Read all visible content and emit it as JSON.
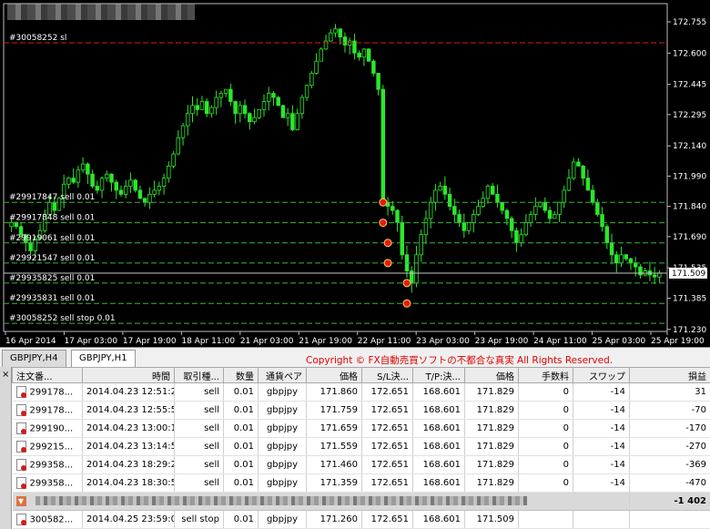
{
  "chart_data": {
    "type": "candlestick",
    "symbol": "GBPJPY,H1",
    "price_axis": [
      "172.755",
      "172.600",
      "172.445",
      "172.295",
      "172.140",
      "171.990",
      "171.840",
      "171.690",
      "171.535",
      "171.385",
      "171.230"
    ],
    "ylim": [
      171.23,
      172.78
    ],
    "current_price": "171.509",
    "time_axis": [
      "16 Apr 2014",
      "17 Apr 03:00",
      "17 Apr 19:00",
      "18 Apr 11:00",
      "21 Apr 03:00",
      "21 Apr 19:00",
      "22 Apr 11:00",
      "23 Apr 03:00",
      "23 Apr 19:00",
      "24 Apr 11:00",
      "25 Apr 03:00",
      "25 Apr 19:00"
    ],
    "order_lines": [
      {
        "label": "#30058252 sl",
        "price": 172.651,
        "color": "#d42020",
        "style": "dash"
      },
      {
        "label": "#29917847 sell 0.01",
        "price": 171.86,
        "color": "#39b539",
        "style": "dash"
      },
      {
        "label": "#29917848 sell 0.01",
        "price": 171.759,
        "color": "#39b539",
        "style": "dash"
      },
      {
        "label": "#29919061 sell 0.01",
        "price": 171.659,
        "color": "#39b539",
        "style": "dash"
      },
      {
        "label": "#29921547 sell 0.01",
        "price": 171.559,
        "color": "#39b539",
        "style": "dash"
      },
      {
        "label": "#29935825 sell 0.01",
        "price": 171.46,
        "color": "#39b539",
        "style": "dash"
      },
      {
        "label": "#29935831 sell 0.01",
        "price": 171.359,
        "color": "#39b539",
        "style": "dash"
      },
      {
        "label": "#30058252 sell stop 0.01",
        "price": 171.26,
        "color": "#39b539",
        "style": "dash"
      }
    ],
    "bid_line": 171.509,
    "grid": false,
    "close_series": [
      171.76,
      171.74,
      171.7,
      171.66,
      171.62,
      171.68,
      171.72,
      171.8,
      171.86,
      171.82,
      171.88,
      171.95,
      171.98,
      171.96,
      172.02,
      172.05,
      172.0,
      171.94,
      171.92,
      171.98,
      172.0,
      171.96,
      171.92,
      171.9,
      171.94,
      171.97,
      171.92,
      171.88,
      171.86,
      171.9,
      171.92,
      171.94,
      171.98,
      172.04,
      172.1,
      172.18,
      172.24,
      172.3,
      172.34,
      172.32,
      172.36,
      172.3,
      172.33,
      172.38,
      172.4,
      172.42,
      172.36,
      172.3,
      172.34,
      172.3,
      172.26,
      172.28,
      172.32,
      172.36,
      172.4,
      172.38,
      172.34,
      172.28,
      172.3,
      172.22,
      172.3,
      172.38,
      172.44,
      172.5,
      172.56,
      172.62,
      172.66,
      172.7,
      172.72,
      172.68,
      172.64,
      172.66,
      172.6,
      172.58,
      172.62,
      172.56,
      172.5,
      172.42,
      171.86,
      171.84,
      171.82,
      171.76,
      171.6,
      171.52,
      171.46,
      171.6,
      171.7,
      171.78,
      171.86,
      171.92,
      171.94,
      171.9,
      171.84,
      171.8,
      171.76,
      171.72,
      171.76,
      171.8,
      171.84,
      171.88,
      171.94,
      171.9,
      171.86,
      171.82,
      171.78,
      171.72,
      171.66,
      171.7,
      171.76,
      171.8,
      171.84,
      171.86,
      171.82,
      171.78,
      171.8,
      171.86,
      171.92,
      171.98,
      172.06,
      172.04,
      171.98,
      171.92,
      171.86,
      171.8,
      171.74,
      171.66,
      171.6,
      171.56,
      171.6,
      171.58,
      171.56,
      171.54,
      171.5,
      171.52,
      171.5,
      171.49,
      171.51
    ],
    "markers": [
      {
        "price": 171.86,
        "index": 78
      },
      {
        "price": 171.759,
        "index": 78
      },
      {
        "price": 171.659,
        "index": 79
      },
      {
        "price": 171.559,
        "index": 79
      },
      {
        "price": 171.46,
        "index": 83
      },
      {
        "price": 171.359,
        "index": 83
      }
    ]
  },
  "tabs": [
    "GBPJPY,H4",
    "GBPJPY,H1"
  ],
  "copyright": "Copyright © FX自動売買ソフトの不都合な真実 All Rights Reserved.",
  "terminal": {
    "close_label": "×",
    "columns": [
      "注文番...",
      "時間",
      "取引種...",
      "数量",
      "通貨ペア",
      "価格",
      "S/L決...",
      "T/P:決...",
      "価格",
      "手数料",
      "スワップ",
      "損益"
    ],
    "rows": [
      {
        "ticket": "299178...",
        "time": "2014.04.23 12:51:22",
        "type": "sell",
        "size": "0.01",
        "symbol": "gbpjpy",
        "price": "171.860",
        "sl": "172.651",
        "tp": "168.601",
        "current": "171.829",
        "commission": "0",
        "swap": "-14",
        "profit": "31"
      },
      {
        "ticket": "299178...",
        "time": "2014.04.23 12:55:55",
        "type": "sell",
        "size": "0.01",
        "symbol": "gbpjpy",
        "price": "171.759",
        "sl": "172.651",
        "tp": "168.601",
        "current": "171.829",
        "commission": "0",
        "swap": "-14",
        "profit": "-70"
      },
      {
        "ticket": "299190...",
        "time": "2014.04.23 13:00:16",
        "type": "sell",
        "size": "0.01",
        "symbol": "gbpjpy",
        "price": "171.659",
        "sl": "172.651",
        "tp": "168.601",
        "current": "171.829",
        "commission": "0",
        "swap": "-14",
        "profit": "-170"
      },
      {
        "ticket": "299215...",
        "time": "2014.04.23 13:14:50",
        "type": "sell",
        "size": "0.01",
        "symbol": "gbpjpy",
        "price": "171.559",
        "sl": "172.651",
        "tp": "168.601",
        "current": "171.829",
        "commission": "0",
        "swap": "-14",
        "profit": "-270"
      },
      {
        "ticket": "299358...",
        "time": "2014.04.23 18:29:20",
        "type": "sell",
        "size": "0.01",
        "symbol": "gbpjpy",
        "price": "171.460",
        "sl": "172.651",
        "tp": "168.601",
        "current": "171.829",
        "commission": "0",
        "swap": "-14",
        "profit": "-369"
      },
      {
        "ticket": "299358...",
        "time": "2014.04.23 18:30:59",
        "type": "sell",
        "size": "0.01",
        "symbol": "gbpjpy",
        "price": "171.359",
        "sl": "172.651",
        "tp": "168.601",
        "current": "171.829",
        "commission": "0",
        "swap": "-14",
        "profit": "-470"
      }
    ],
    "total_profit": "-1 402",
    "pending": {
      "ticket": "300582...",
      "time": "2014.04.25 23:59:01",
      "type": "sell stop",
      "size": "0.01",
      "symbol": "gbpjpy",
      "price": "171.260",
      "sl": "172.651",
      "tp": "168.601",
      "current": "171.509"
    }
  }
}
